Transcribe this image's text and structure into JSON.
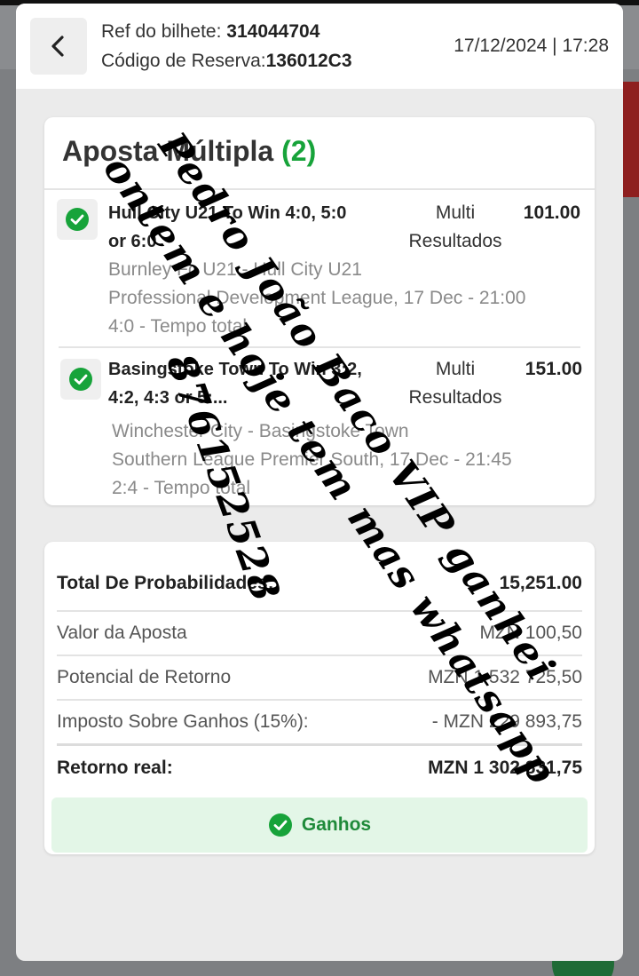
{
  "header": {
    "ref_label": "Ref do bilhete:",
    "ref_value": "314044704",
    "booking_label": "Código de Reserva:",
    "booking_value": "136012C3",
    "datetime": "17/12/2024 | 17:28"
  },
  "bet": {
    "title": "Aposta Múltipla",
    "count": "(2)",
    "selections": [
      {
        "market": "Hull City U21 To Win 4:0, 5:0 or 6:0",
        "type": "Multi Resultados",
        "odds": "101.00",
        "match": "Burnley Fc U21 - Hull City U21",
        "league": "Professional Development League, 17 Dec - 21:00",
        "result": "4:0 - Tempo total"
      },
      {
        "market": "Basingstoke Town To Win 3:2, 4:2, 4:3 or 5:...",
        "type": "Multi Resultados",
        "odds": "151.00",
        "match": "Winchester City - Basingstoke Town",
        "league": "Southern League Premier South, 17 Dec - 21:45",
        "result": "2:4 - Tempo total"
      }
    ]
  },
  "summary": {
    "total_odds_label": "Total De Probabilidades:",
    "total_odds_value": "15,251.00",
    "stake_label": "Valor da Aposta",
    "stake_value": "MZN 100,50",
    "potential_label": "Potencial de Retorno",
    "potential_value": "MZN 1 532 725,50",
    "tax_label": "Imposto Sobre Ganhos (15%):",
    "tax_value": "- MZN 229 893,75",
    "net_label": "Retorno real:",
    "net_value": "MZN 1 302 831,75",
    "status": "Ganhos"
  },
  "overlay_text": {
    "line1": "Pedro João Baco VIP ganhei",
    "line2": "ontem e hoje tem mas whatsapp",
    "line3": "876152528"
  },
  "colors": {
    "accent_green": "#17a33a",
    "won_bg": "#e3f6e7"
  }
}
